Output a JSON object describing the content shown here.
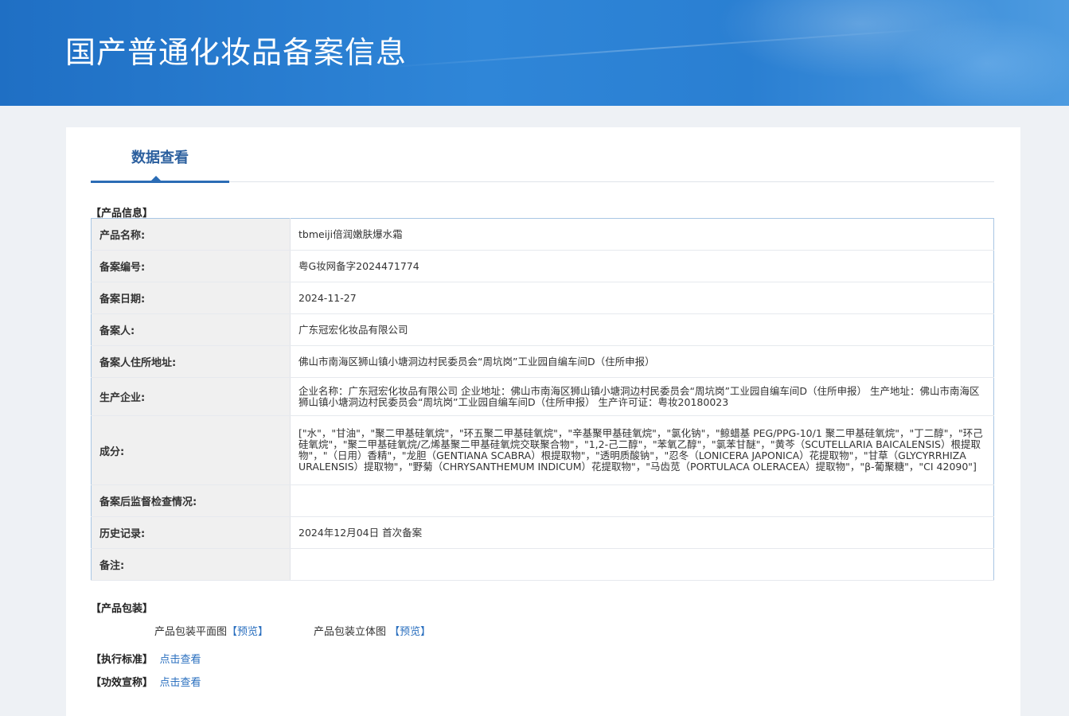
{
  "header": {
    "title": "国产普通化妆品备案信息"
  },
  "tabs": [
    {
      "label": "数据查看"
    }
  ],
  "product_info": {
    "section_title": "【产品信息】",
    "rows": [
      {
        "key": "产品名称:",
        "value": "tbmeiji倍润嫩肤爆水霜"
      },
      {
        "key": "备案编号:",
        "value": "粤G妆网备字2024471774"
      },
      {
        "key": "备案日期:",
        "value": "2024-11-27"
      },
      {
        "key": "备案人:",
        "value": "广东冠宏化妆品有限公司"
      },
      {
        "key": "备案人住所地址:",
        "value": "佛山市南海区狮山镇小塘洞边村民委员会“周坑岗”工业园自编车间D（住所申报）"
      },
      {
        "key": "生产企业:",
        "value": "企业名称：广东冠宏化妆品有限公司 企业地址：佛山市南海区狮山镇小塘洞边村民委员会“周坑岗”工业园自编车间D（住所申报） 生产地址：佛山市南海区狮山镇小塘洞边村民委员会“周坑岗”工业园自编车间D（住所申报） 生产许可证：粤妆20180023"
      },
      {
        "key": "成分:",
        "value": "[\"水\"，\"甘油\"，\"聚二甲基硅氧烷\"，\"环五聚二甲基硅氧烷\"，\"辛基聚甲基硅氧烷\"，\"氯化钠\"，\"鲸蜡基 PEG/PPG-10/1 聚二甲基硅氧烷\"，\"丁二醇\"，\"环己硅氧烷\"，\"聚二甲基硅氧烷/乙烯基聚二甲基硅氧烷交联聚合物\"，\"1,2-己二醇\"，\"苯氧乙醇\"，\"氯苯甘醚\"，\"黄芩（SCUTELLARIA BAICALENSIS）根提取物\"，\"（日用）香精\"，\"龙胆（GENTIANA SCABRA）根提取物\"，\"透明质酸钠\"，\"忍冬（LONICERA JAPONICA）花提取物\"，\"甘草（GLYCYRRHIZA URALENSIS）提取物\"，\"野菊（CHRYSANTHEMUM INDICUM）花提取物\"，\"马齿苋（PORTULACA OLERACEA）提取物\"，\"β-葡聚糖\"，\"CI 42090\"]"
      },
      {
        "key": "备案后监督检查情况:",
        "value": ""
      },
      {
        "key": "历史记录:",
        "value": "2024年12月04日 首次备案"
      },
      {
        "key": "备注:",
        "value": ""
      }
    ]
  },
  "packaging": {
    "section_title": "【产品包装】",
    "flat_label": "产品包装平面图",
    "flat_link": "【预览】",
    "solid_label": "产品包装立体图",
    "solid_link": "【预览】"
  },
  "standard": {
    "section_title": "【执行标准】",
    "link": "点击查看"
  },
  "efficacy": {
    "section_title": "【功效宣称】",
    "link": "点击查看"
  }
}
